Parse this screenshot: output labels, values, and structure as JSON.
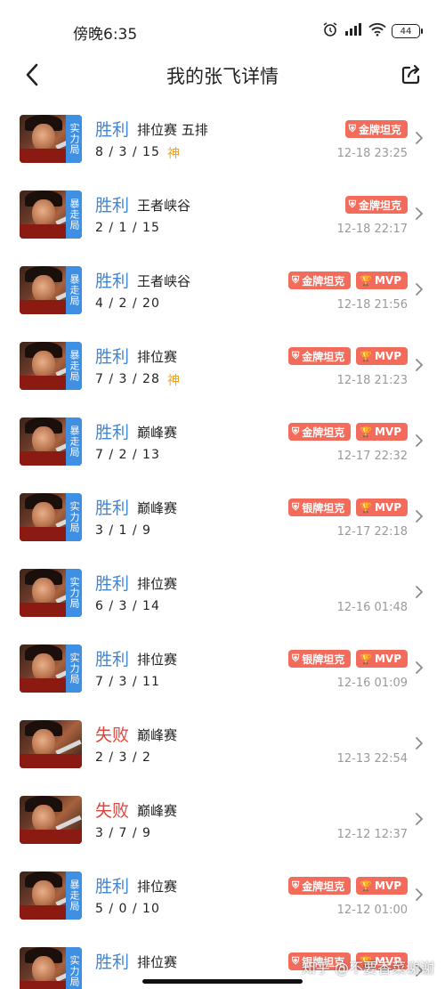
{
  "status": {
    "time": "傍晚6:35",
    "battery": "44"
  },
  "nav": {
    "title": "我的张飞详情"
  },
  "rows": [
    {
      "result": "胜利",
      "outcome": "win",
      "mode": "排位赛 五排",
      "kda": "8 / 3 / 15",
      "shen": "神",
      "tag": "实力局",
      "badges": [
        "金牌坦克"
      ],
      "time": "12-18 23:25"
    },
    {
      "result": "胜利",
      "outcome": "win",
      "mode": "王者峡谷",
      "kda": "2 / 1 / 15",
      "shen": "",
      "tag": "暴走局",
      "badges": [
        "金牌坦克"
      ],
      "time": "12-18 22:17"
    },
    {
      "result": "胜利",
      "outcome": "win",
      "mode": "王者峡谷",
      "kda": "4 / 2 / 20",
      "shen": "",
      "tag": "暴走局",
      "badges": [
        "金牌坦克",
        "MVP"
      ],
      "time": "12-18 21:56"
    },
    {
      "result": "胜利",
      "outcome": "win",
      "mode": "排位赛",
      "kda": "7 / 3 / 28",
      "shen": "神",
      "tag": "暴走局",
      "badges": [
        "金牌坦克",
        "MVP"
      ],
      "time": "12-18 21:23"
    },
    {
      "result": "胜利",
      "outcome": "win",
      "mode": "巅峰赛",
      "kda": "7 / 2 / 13",
      "shen": "",
      "tag": "暴走局",
      "badges": [
        "金牌坦克",
        "MVP"
      ],
      "time": "12-17 22:32"
    },
    {
      "result": "胜利",
      "outcome": "win",
      "mode": "巅峰赛",
      "kda": "3 / 1 / 9",
      "shen": "",
      "tag": "实力局",
      "badges": [
        "银牌坦克",
        "MVP"
      ],
      "time": "12-17 22:18"
    },
    {
      "result": "胜利",
      "outcome": "win",
      "mode": "排位赛",
      "kda": "6 / 3 / 14",
      "shen": "",
      "tag": "实力局",
      "badges": [],
      "time": "12-16 01:48"
    },
    {
      "result": "胜利",
      "outcome": "win",
      "mode": "排位赛",
      "kda": "7 / 3 / 11",
      "shen": "",
      "tag": "实力局",
      "badges": [
        "银牌坦克",
        "MVP"
      ],
      "time": "12-16 01:09"
    },
    {
      "result": "失败",
      "outcome": "loss",
      "mode": "巅峰赛",
      "kda": "2 / 3 / 2",
      "shen": "",
      "tag": "",
      "badges": [],
      "time": "12-13 22:54"
    },
    {
      "result": "失败",
      "outcome": "loss",
      "mode": "巅峰赛",
      "kda": "3 / 7 / 9",
      "shen": "",
      "tag": "",
      "badges": [],
      "time": "12-12 12:37"
    },
    {
      "result": "胜利",
      "outcome": "win",
      "mode": "排位赛",
      "kda": "5 / 0 / 10",
      "shen": "",
      "tag": "暴走局",
      "badges": [
        "金牌坦克",
        "MVP"
      ],
      "time": "12-12 01:00"
    },
    {
      "result": "胜利",
      "outcome": "win",
      "mode": "排位赛",
      "kda": "",
      "shen": "",
      "tag": "实力局",
      "badges": [
        "银牌坦克",
        "MVP"
      ],
      "time": ""
    }
  ],
  "watermark": "知乎 @不要香菜谢谢",
  "colors": {
    "win": "#3e86d9",
    "loss": "#e0453d",
    "badge": "#f26b5b",
    "tag": "#3f8fe3",
    "shen": "#f0a020"
  }
}
